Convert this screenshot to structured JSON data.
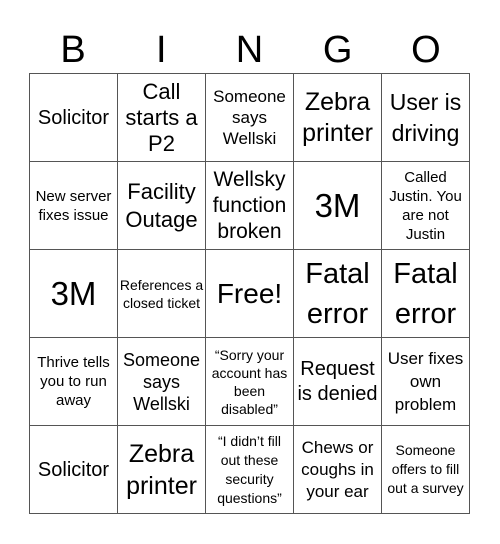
{
  "header": {
    "letters": [
      "B",
      "I",
      "N",
      "G",
      "O"
    ]
  },
  "cells": [
    [
      "Solicitor",
      "Call starts a P2",
      "Someone says Wellski",
      "Zebra printer",
      "User is driving"
    ],
    [
      "New server fixes issue",
      "Facility Outage",
      "Wellsky function broken",
      "3M",
      "Called Justin. You are not Justin"
    ],
    [
      "3M",
      "References a closed ticket",
      "Free!",
      "Fatal error",
      "Fatal error"
    ],
    [
      "Thrive tells you to run away",
      "Someone says Wellski",
      "“Sorry your account has been disabled”",
      "Request is denied",
      "User fixes own problem"
    ],
    [
      "Solicitor",
      "Zebra printer",
      "“I didn’t fill out these security questions”",
      "Chews or coughs in your ear",
      "Someone offers to fill out a survey"
    ]
  ],
  "colors": {
    "grid_line": "#555555",
    "text": "#000000",
    "background": "#ffffff"
  }
}
